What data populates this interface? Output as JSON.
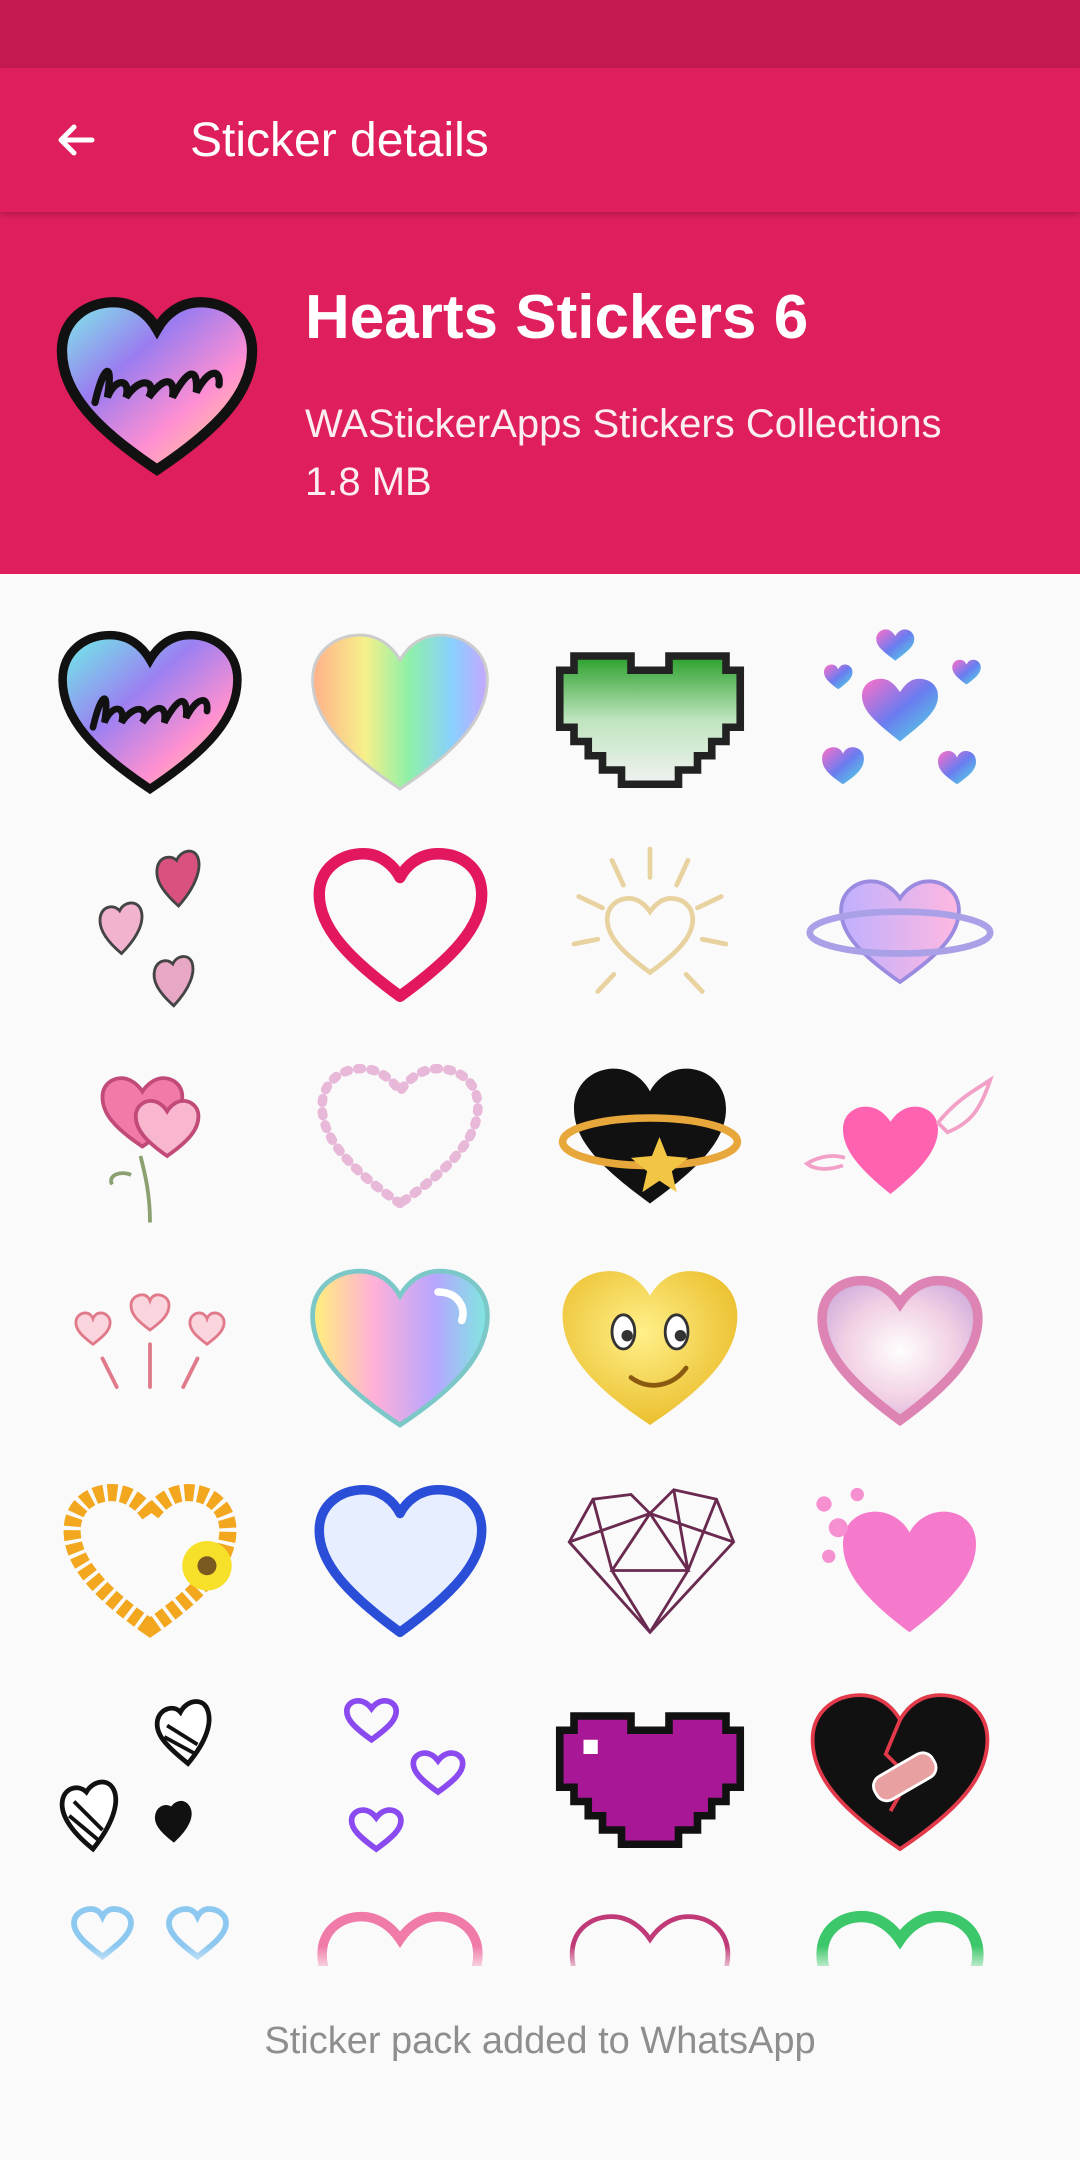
{
  "app_bar": {
    "title": "Sticker details",
    "back_icon": "arrow-back-icon"
  },
  "pack": {
    "name": "Hearts Stickers 6",
    "publisher": "WAStickerApps Stickers Collections",
    "size": "1.8 MB"
  },
  "colors": {
    "accent": "#de1f5c",
    "status_bar": "#c41a50",
    "background": "#fafafa"
  },
  "footer": {
    "status_text": "Sticker pack added to WhatsApp"
  }
}
